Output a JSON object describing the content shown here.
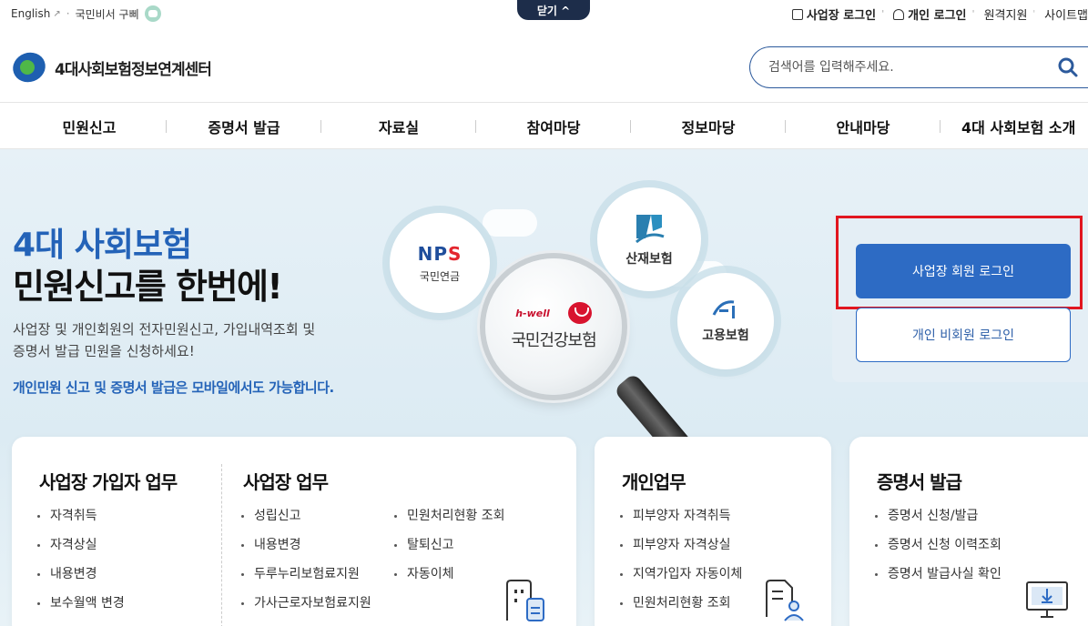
{
  "topbar": {
    "english": "English",
    "secretary": "국민비서 구삐",
    "close_tab": "닫기 ^",
    "business_login": "사업장 로그인",
    "personal_login": "개인 로그인",
    "remote_support": "원격지원",
    "sitemap": "사이트맵"
  },
  "header": {
    "logo_text": "4대사회보험정보연계센터",
    "search_placeholder": "검색어를 입력해주세요."
  },
  "nav": {
    "items": [
      "민원신고",
      "증명서 발급",
      "자료실",
      "참여마당",
      "정보마당",
      "안내마당",
      "4대 사회보험 소개"
    ]
  },
  "hero": {
    "title_line1": "4대 사회보험",
    "title_line2": "민원신고를 한번에!",
    "desc_line1": "사업장 및 개인회원의 전자민원신고, 가입내역조회 및",
    "desc_line2": "증명서 발급 민원을 신청하세요!",
    "note": "개인민원 신고 및 증명서 발급은 모바일에서도 가능합니다.",
    "nps_label": "국민연금",
    "nps_logo_n": "NP",
    "nps_logo_s": "S",
    "kcomwel_label": "산재보험",
    "ei_label": "고용보험",
    "nhis_small": "h-well",
    "nhis_label": "국민건강보험"
  },
  "login": {
    "business_button": "사업장 회원 로그인",
    "guest_button": "개인 비회원 로그인"
  },
  "cards": {
    "biz_subscriber": {
      "title": "사업장 가입자 업무",
      "items": [
        "자격취득",
        "자격상실",
        "내용변경",
        "보수월액 변경"
      ]
    },
    "biz": {
      "title": "사업장 업무",
      "col1": [
        "성립신고",
        "내용변경",
        "두루누리보험료지원",
        "가사근로자보험료지원"
      ],
      "col2": [
        "민원처리현황 조회",
        "탈퇴신고",
        "자동이체"
      ]
    },
    "personal": {
      "title": "개인업무",
      "items": [
        "피부양자 자격취득",
        "피부양자 자격상실",
        "지역가입자 자동이체",
        "민원처리현황 조회"
      ]
    },
    "cert": {
      "title": "증명서 발급",
      "items": [
        "증명서 신청/발급",
        "증명서 신청 이력조회",
        "증명서 발급사실 확인"
      ]
    }
  },
  "colors": {
    "primary": "#2d6bc4",
    "hero_title": "#2463b8",
    "highlight": "#e1161f",
    "navy": "#1d2d4a"
  }
}
